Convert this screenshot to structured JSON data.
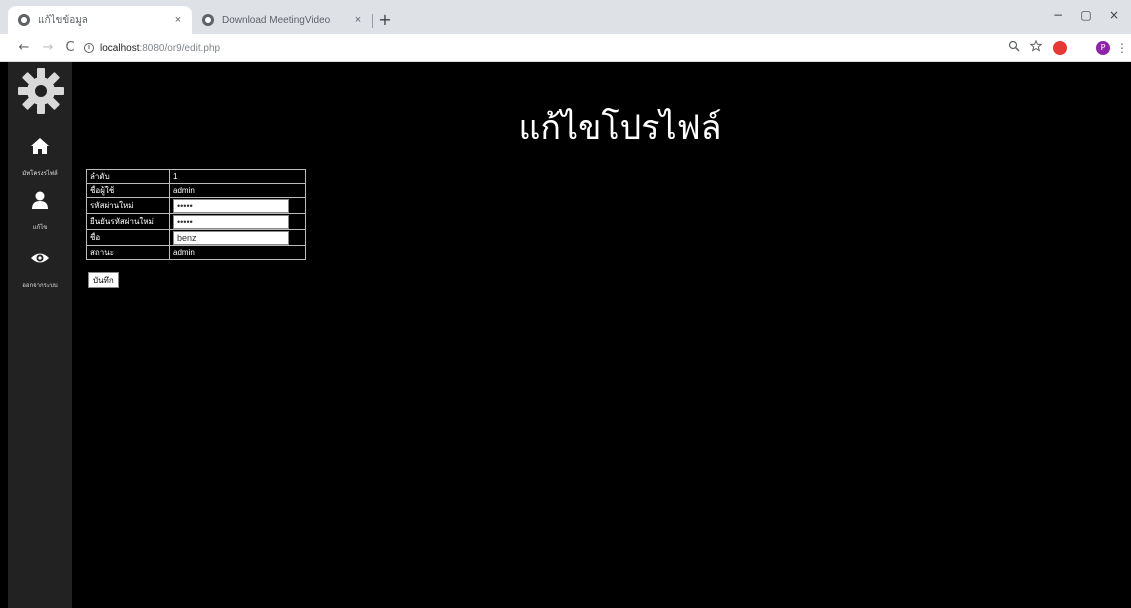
{
  "browser": {
    "tabs": [
      {
        "title": "แก้ไขข้อมูล",
        "close": "×",
        "active": true
      },
      {
        "title": "Download MeetingVideo",
        "close": "×",
        "active": false
      }
    ],
    "new_tab": "+",
    "window_controls": {
      "minimize": "−",
      "maximize": "▢",
      "close": "×"
    },
    "nav": {
      "back": "←",
      "forward": "→",
      "reload": "C"
    },
    "address": {
      "host": "localhost",
      "path": ":8080/or9/edit.php",
      "info_icon": "i"
    },
    "toolbar_icons": [
      "zoom-icon",
      "star-icon",
      "adblock-icon",
      "profile-avatar"
    ],
    "profile_initial": "P",
    "colors": {
      "tabbar": "#dee1e6",
      "adblock": "#e53935",
      "profile": "#8e24aa"
    }
  },
  "sidebar": {
    "logo_icon": "gear-icon",
    "items": [
      {
        "icon": "home-icon",
        "label": "มัทโครงรไฟล์"
      },
      {
        "icon": "user-icon",
        "label": "แก้ไข"
      },
      {
        "icon": "eye-icon",
        "label": "ออกจากระบบ"
      }
    ]
  },
  "main": {
    "title": "แก้ไขโปรไฟล์",
    "rows": [
      {
        "label": "ลำดับ",
        "value": "1"
      },
      {
        "label": "ชื่อผู้ใช้",
        "value": "admin"
      },
      {
        "label": "รหัสผ่านใหม่",
        "input_value": "•••••"
      },
      {
        "label": "ยืนยันรหัสผ่านใหม่",
        "input_value": "•••••"
      },
      {
        "label": "ชื่อ",
        "input_value": "benz"
      },
      {
        "label": "สถานะ",
        "value": "admin"
      }
    ],
    "save_label": "บันทึก"
  }
}
